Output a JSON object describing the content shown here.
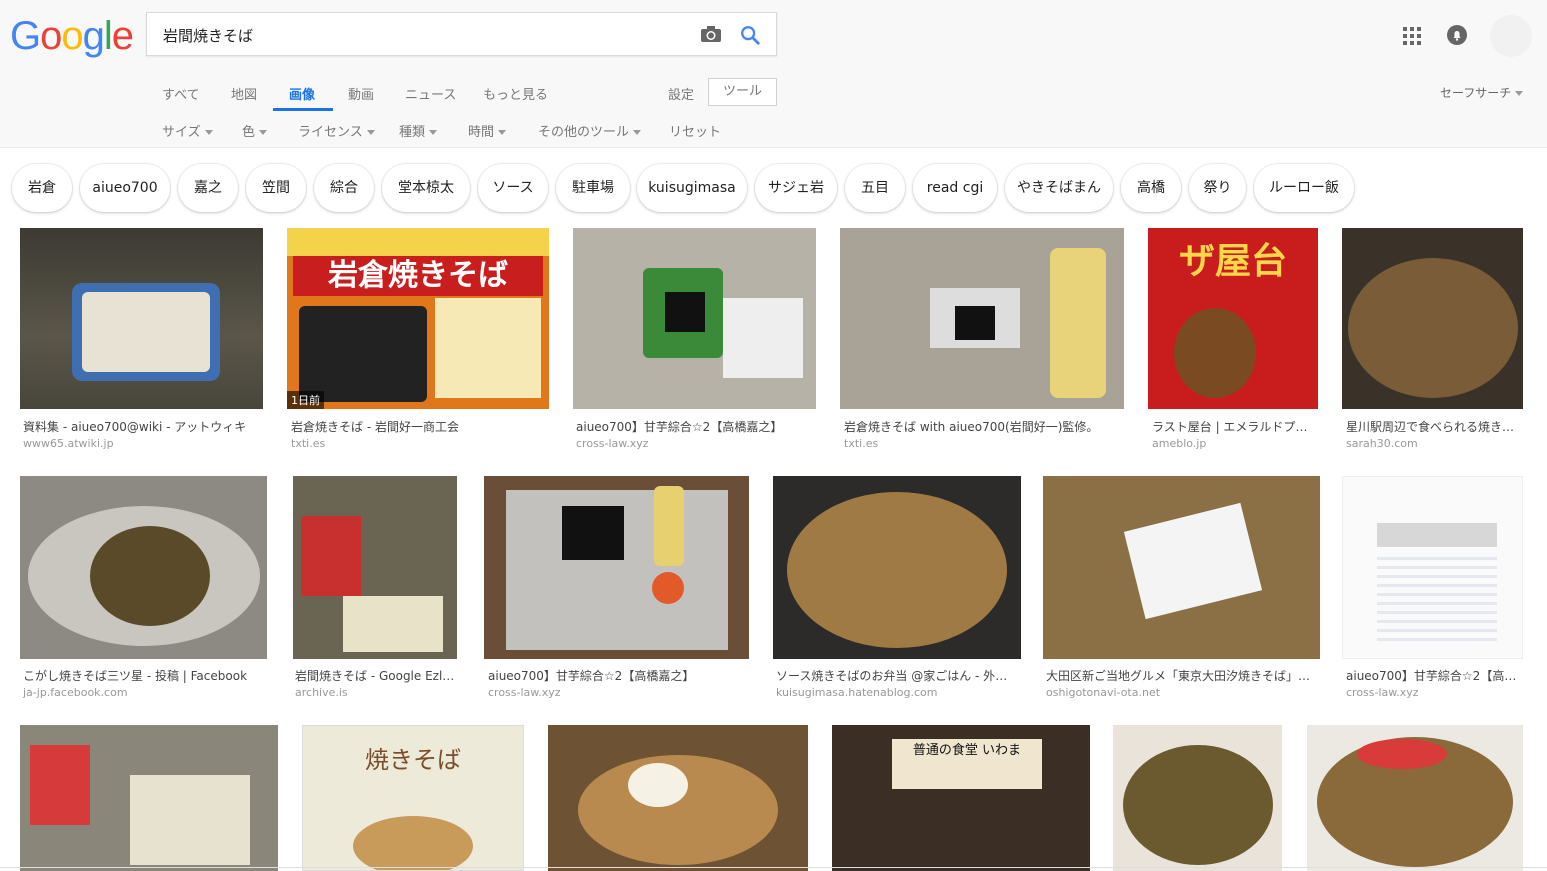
{
  "search": {
    "query": "岩間焼きそば"
  },
  "logo": {
    "text": "Google",
    "colors": [
      "#4285F4",
      "#EA4335",
      "#FBBC05",
      "#4285F4",
      "#34A853",
      "#EA4335"
    ]
  },
  "tabs": [
    {
      "label": "すべて"
    },
    {
      "label": "地図"
    },
    {
      "label": "画像"
    },
    {
      "label": "動画"
    },
    {
      "label": "ニュース"
    },
    {
      "label": "もっと見る"
    }
  ],
  "toolbar": {
    "settings_label": "設定",
    "tools_label": "ツール",
    "safesearch_label": "セーフサーチ"
  },
  "filters": [
    {
      "label": "サイズ"
    },
    {
      "label": "色"
    },
    {
      "label": "ライセンス"
    },
    {
      "label": "種類"
    },
    {
      "label": "時間"
    },
    {
      "label": "その他のツール"
    },
    {
      "label": "リセット"
    }
  ],
  "chips": [
    {
      "label": "岩倉"
    },
    {
      "label": "aiueo700"
    },
    {
      "label": "嘉之"
    },
    {
      "label": "笠間"
    },
    {
      "label": "綜合"
    },
    {
      "label": "堂本椋太"
    },
    {
      "label": "ソース"
    },
    {
      "label": "駐車場"
    },
    {
      "label": "kuisugimasa"
    },
    {
      "label": "サジェ岩"
    },
    {
      "label": "五目"
    },
    {
      "label": "read cgi"
    },
    {
      "label": "やきそばまん"
    },
    {
      "label": "高橋"
    },
    {
      "label": "祭り"
    },
    {
      "label": "ルーロー飯"
    }
  ],
  "results": [
    {
      "title": "資料集 - aiueo700@wiki - アットウィキ",
      "source": "www65.atwiki.jp"
    },
    {
      "title": "岩倉焼きそば - 岩間好一商工会",
      "source": "txti.es",
      "badge": "1日前",
      "image_text": "岩倉焼きそば"
    },
    {
      "title": "aiueo700】甘芋綜合☆2【高橋嘉之】",
      "source": "cross-law.xyz"
    },
    {
      "title": "岩倉焼きそば with aiueo700(岩間好一)監修。",
      "source": "txti.es"
    },
    {
      "title": "ラスト屋台 | エメラルドプレイ…",
      "source": "ameblo.jp",
      "image_text": "ザ屋台"
    },
    {
      "title": "星川駅周辺で食べられる焼き…",
      "source": "sarah30.com"
    },
    {
      "title": "こがし焼きそば三ツ星 - 投稿 | Facebook",
      "source": "ja-jp.facebook.com"
    },
    {
      "title": "岩間焼きそば - Google Ezl…",
      "source": "archive.is"
    },
    {
      "title": "aiueo700】甘芋綜合☆2【高橋嘉之】",
      "source": "cross-law.xyz"
    },
    {
      "title": "ソース焼きそばのお弁当 @家ごはん - 外ご…",
      "source": "kuisugimasa.hatenablog.com"
    },
    {
      "title": "大田区新ご当地グルメ「東京大田汐焼きそば」誕…",
      "source": "oshigotonavi-ota.net"
    },
    {
      "title": "aiueo700】甘芋綜合☆2【高…",
      "source": "cross-law.xyz"
    },
    {
      "title": "",
      "source": ""
    },
    {
      "title": "",
      "source": "",
      "image_text": "焼きそば"
    },
    {
      "title": "",
      "source": ""
    },
    {
      "title": "",
      "source": "",
      "image_text": "普通の食堂 いわま"
    },
    {
      "title": "",
      "source": ""
    },
    {
      "title": "",
      "source": ""
    }
  ],
  "colors": {
    "accent": "#1a73e8",
    "header_bg": "#f8f8f8"
  }
}
